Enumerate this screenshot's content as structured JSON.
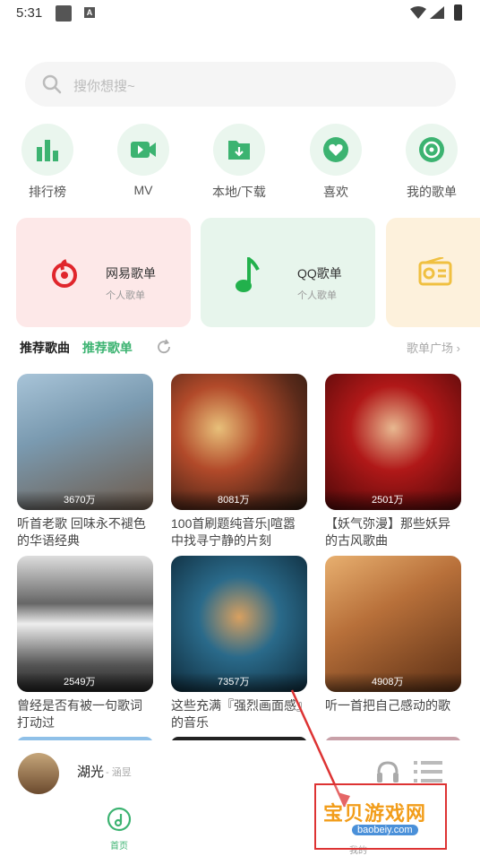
{
  "status": {
    "time": "5:31"
  },
  "search": {
    "placeholder": "搜你想搜~"
  },
  "categories": [
    {
      "label": "排行榜",
      "icon": "bar-chart-icon"
    },
    {
      "label": "MV",
      "icon": "video-camera-icon"
    },
    {
      "label": "本地/下载",
      "icon": "folder-download-icon"
    },
    {
      "label": "喜欢",
      "icon": "heart-icon"
    },
    {
      "label": "我的歌单",
      "icon": "playlist-disc-icon"
    }
  ],
  "cards": [
    {
      "title": "网易歌单",
      "sub": "个人歌单",
      "icon": "netease-icon"
    },
    {
      "title": "QQ歌单",
      "sub": "个人歌单",
      "icon": "qq-music-note-icon"
    },
    {
      "title": "",
      "sub": "",
      "icon": "radio-icon"
    }
  ],
  "tabs": {
    "primary": "推荐歌曲",
    "secondary": "推荐歌单",
    "square": "歌单广场 ›"
  },
  "tiles": [
    {
      "count": "3670万",
      "caption": "听首老歌 回味永不褪色的华语经典"
    },
    {
      "count": "8081万",
      "caption": "100首刷题纯音乐|喧嚣中找寻宁静的片刻"
    },
    {
      "count": "2501万",
      "caption": "【妖气弥漫】那些妖异的古风歌曲"
    },
    {
      "count": "2549万",
      "caption": "曾经是否有被一句歌词打动过"
    },
    {
      "count": "7357万",
      "caption": "这些充满『强烈画面感』的音乐"
    },
    {
      "count": "4908万",
      "caption": "听一首把自己感动的歌"
    }
  ],
  "player": {
    "song": "湖光",
    "artist": "- 涵昱"
  },
  "nav": {
    "home": "首页",
    "mine": "我的"
  },
  "watermark": {
    "text": "宝贝游戏网",
    "url": "baobeiy.com"
  }
}
